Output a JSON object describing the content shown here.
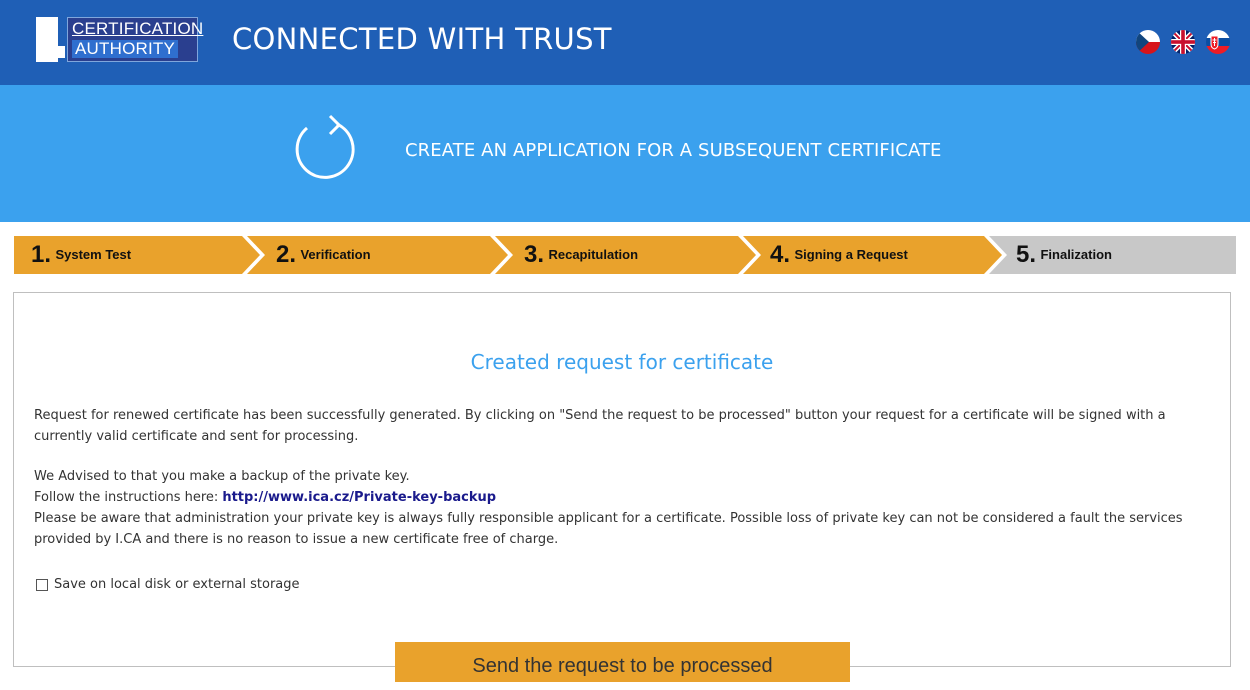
{
  "header": {
    "logo_line1": "CERTIFICATION",
    "logo_line2": "AUTHORITY",
    "tagline": "CONNECTED WITH TRUST",
    "flags": [
      "czech-flag-icon",
      "uk-flag-icon",
      "slovak-flag-icon"
    ]
  },
  "banner": {
    "icon": "refresh-icon",
    "title": "CREATE AN APPLICATION FOR A SUBSEQUENT CERTIFICATE"
  },
  "steps": [
    {
      "num": "1.",
      "label": "System Test"
    },
    {
      "num": "2.",
      "label": "Verification"
    },
    {
      "num": "3.",
      "label": "Recapitulation"
    },
    {
      "num": "4.",
      "label": "Signing a Request"
    },
    {
      "num": "5.",
      "label": "Finalization"
    }
  ],
  "content": {
    "title": "Created request for certificate",
    "para1": "Request for renewed certificate has been successfully generated. By clicking on \"Send the request to be processed\" button your request for a certificate will be signed with a currently valid certificate and sent for processing.",
    "para2": "We Advised to that you make a backup of the private key.",
    "para3_prefix": "Follow the instructions here:",
    "para3_link": "http://www.ica.cz/Private-key-backup",
    "para4": "Please be aware that administration your private key is always fully responsible applicant for a certificate. Possible loss of private key can not be considered a fault the services provided by I.CA and there is no reason to issue a new certificate free of charge.",
    "checkbox_label": "Save on local disk or external storage",
    "checkbox_checked": false
  },
  "actions": {
    "send_label": "Send the request to be processed"
  },
  "colors": {
    "header_bg": "#1f5fb6",
    "banner_bg": "#3ba1ee",
    "step_active": "#e9a22c",
    "step_inactive": "#c8c8c8",
    "title_accent": "#3ba1ee",
    "link": "#1a1a8c"
  }
}
